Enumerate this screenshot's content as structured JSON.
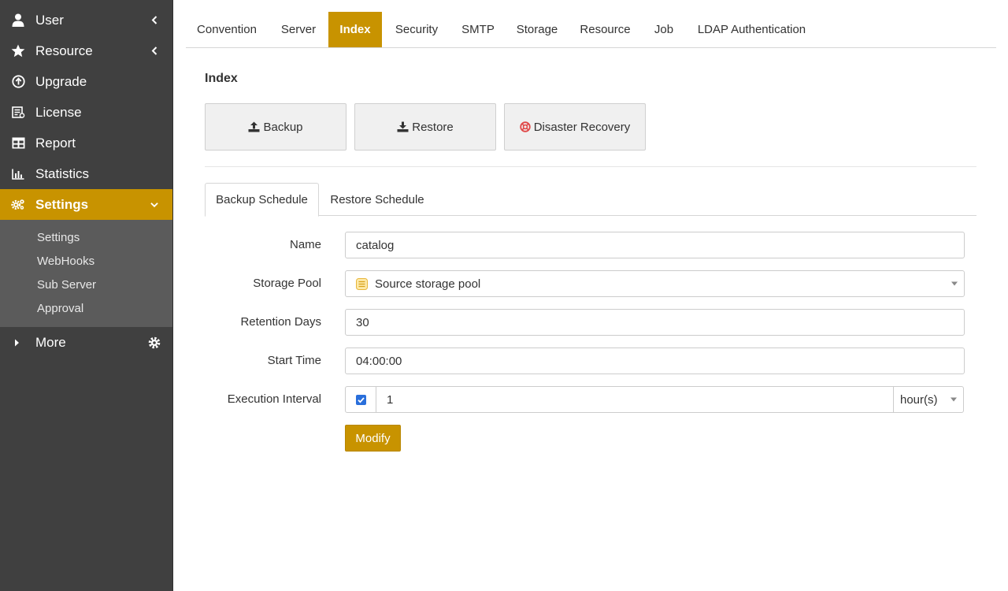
{
  "sidebar": {
    "items": [
      {
        "label": "User",
        "icon": "user-icon"
      },
      {
        "label": "Resource",
        "icon": "star-icon"
      },
      {
        "label": "Upgrade",
        "icon": "upgrade-icon"
      },
      {
        "label": "License",
        "icon": "license-icon"
      },
      {
        "label": "Report",
        "icon": "table-icon"
      },
      {
        "label": "Statistics",
        "icon": "bar-chart-icon"
      },
      {
        "label": "Settings",
        "icon": "cogs-icon"
      }
    ],
    "submenu": [
      "Settings",
      "WebHooks",
      "Sub Server",
      "Approval"
    ],
    "more_label": "More"
  },
  "tabs": [
    "Convention",
    "Server",
    "Index",
    "Security",
    "SMTP",
    "Storage",
    "Resource",
    "Job",
    "LDAP Authentication"
  ],
  "active_tab": "Index",
  "section_title": "Index",
  "actions": {
    "backup": "Backup",
    "restore": "Restore",
    "disaster_recovery": "Disaster Recovery"
  },
  "subtabs": [
    "Backup Schedule",
    "Restore Schedule"
  ],
  "form": {
    "name_label": "Name",
    "name_value": "catalog",
    "storage_pool_label": "Storage Pool",
    "storage_pool_value": "Source storage pool",
    "retention_label": "Retention Days",
    "retention_value": "30",
    "start_time_label": "Start Time",
    "start_time_value": "04:00:00",
    "interval_label": "Execution Interval",
    "interval_checked": true,
    "interval_value": "1",
    "interval_unit": "hour(s)",
    "submit_label": "Modify"
  },
  "colors": {
    "accent": "#c89300",
    "sidebar_bg": "#404040",
    "submenu_bg": "#5b5b5b",
    "checkbox": "#2a6fdb",
    "disaster_icon": "#e04848"
  }
}
